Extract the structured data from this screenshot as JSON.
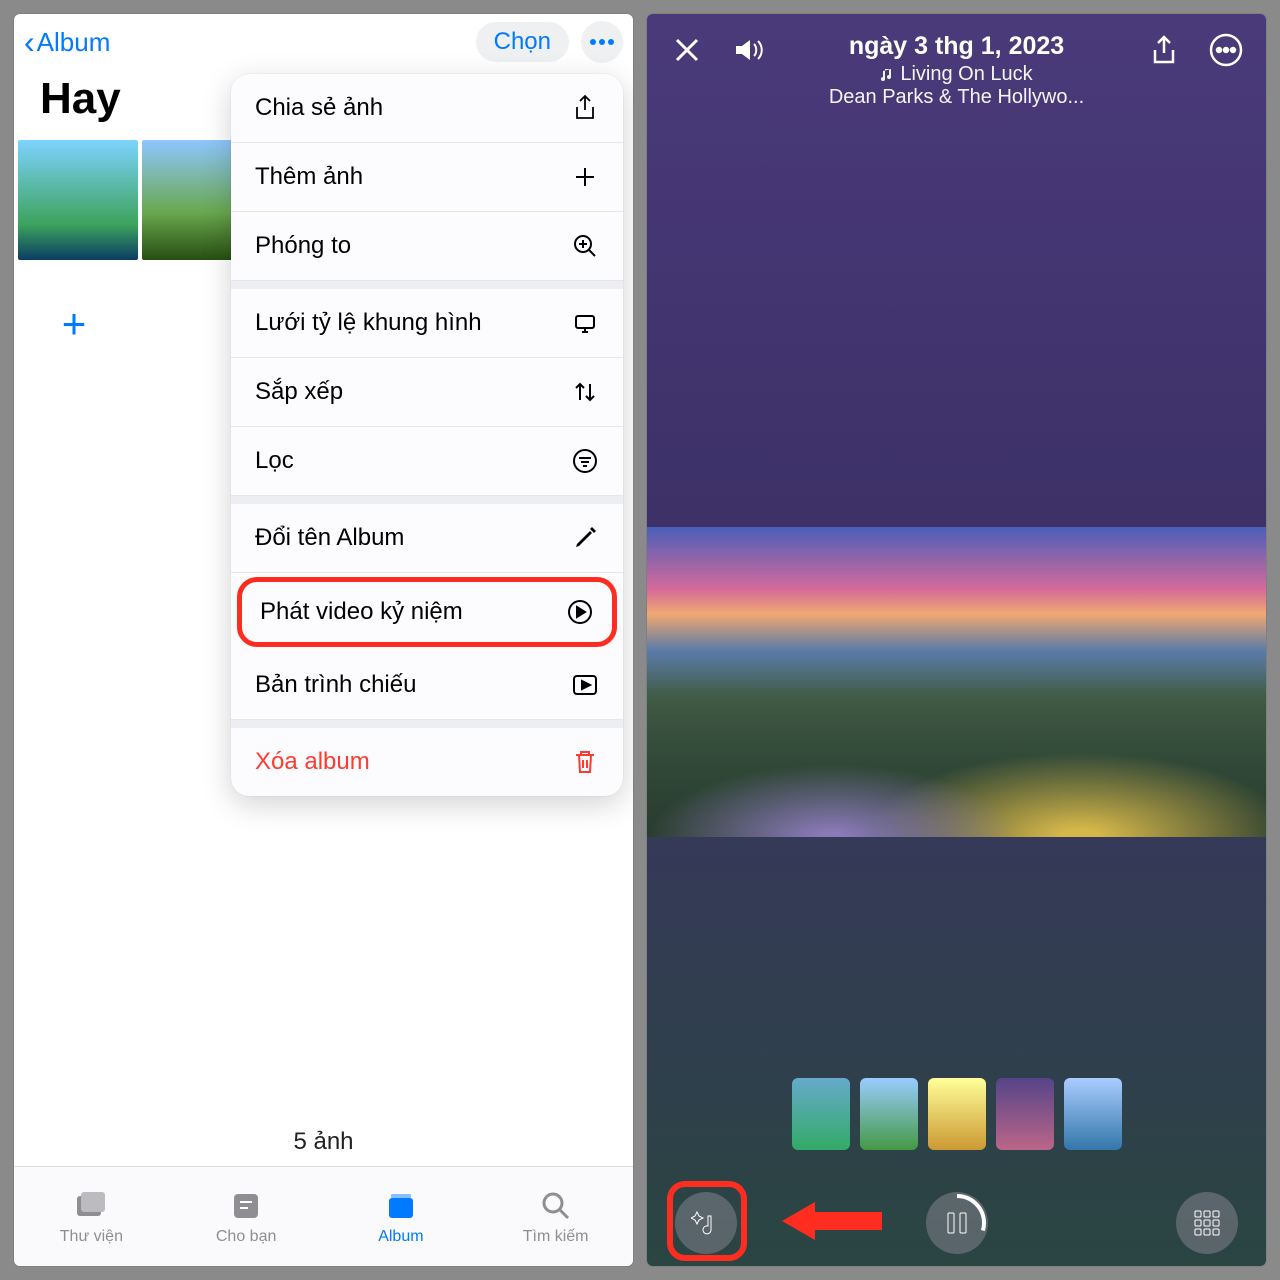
{
  "left": {
    "back_label": "Album",
    "select_label": "Chọn",
    "title": "Hay",
    "photo_count": "5 ảnh",
    "menu": {
      "share": "Chia sẻ ảnh",
      "add": "Thêm ảnh",
      "zoom": "Phóng to",
      "aspect": "Lưới tỷ lệ khung hình",
      "sort": "Sắp xếp",
      "filter": "Lọc",
      "rename": "Đổi tên Album",
      "memory": "Phát video kỷ niệm",
      "slideshow": "Bản trình chiếu",
      "delete": "Xóa album"
    },
    "tabs": {
      "library": "Thư viện",
      "foryou": "Cho bạn",
      "album": "Album",
      "search": "Tìm kiếm"
    }
  },
  "right": {
    "date": "ngày 3 thg 1, 2023",
    "song": "Living On Luck",
    "artist": "Dean Parks & The Hollywo..."
  }
}
